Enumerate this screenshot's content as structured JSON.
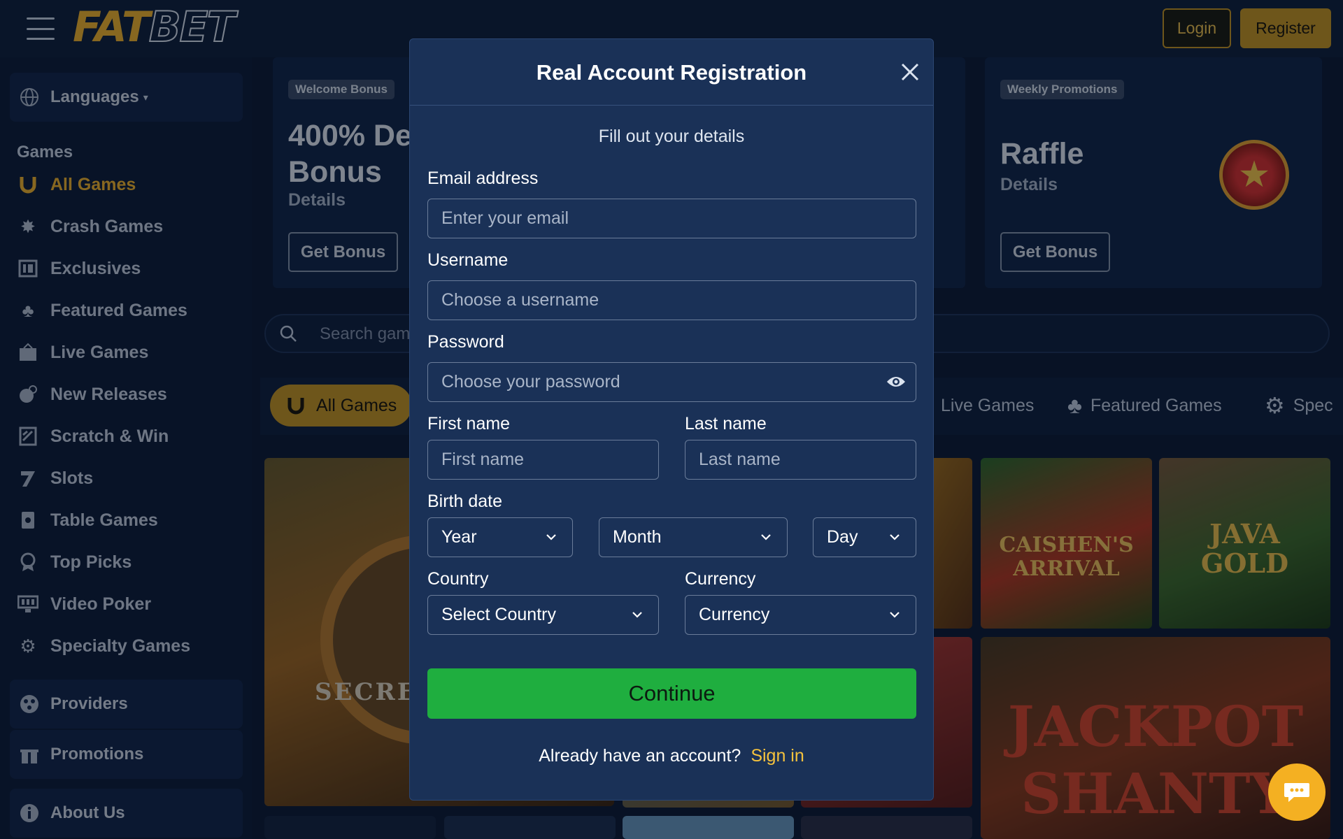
{
  "header": {
    "logo_fat": "FAT",
    "logo_bet": "BET",
    "login_label": "Login",
    "register_label": "Register"
  },
  "sidebar": {
    "languages_label": "Languages",
    "games_heading": "Games",
    "items": [
      {
        "label": "All Games",
        "icon": "horseshoe-icon",
        "active": true
      },
      {
        "label": "Crash Games",
        "icon": "crash-icon"
      },
      {
        "label": "Exclusives",
        "icon": "exclusive-icon"
      },
      {
        "label": "Featured Games",
        "icon": "clover-icon"
      },
      {
        "label": "Live Games",
        "icon": "live-icon"
      },
      {
        "label": "New Releases",
        "icon": "new-icon"
      },
      {
        "label": "Scratch & Win",
        "icon": "scratch-icon"
      },
      {
        "label": "Slots",
        "icon": "slot-icon"
      },
      {
        "label": "Table Games",
        "icon": "table-icon"
      },
      {
        "label": "Top Picks",
        "icon": "top-picks-icon"
      },
      {
        "label": "Video Poker",
        "icon": "video-poker-icon"
      },
      {
        "label": "Specialty Games",
        "icon": "gear-icon"
      }
    ],
    "providers_label": "Providers",
    "promotions_label": "Promotions",
    "about_label": "About Us"
  },
  "promos": {
    "welcome_tag": "Welcome Bonus",
    "welcome_title_line1": "400% De",
    "welcome_title_line2": "Bonus",
    "welcome_details": "Details",
    "welcome_button": "Get Bonus",
    "weekly_tag": "Weekly Promotions",
    "weekly_title": "Raffle",
    "weekly_details": "Details",
    "weekly_button": "Get Bonus"
  },
  "search": {
    "placeholder": "Search gam"
  },
  "categories": {
    "all_games": "All Games",
    "live_games": "Live Games",
    "featured_games": "Featured Games",
    "specialty": "Spec"
  },
  "tiles": {
    "secret": "SECRET",
    "caishens": "CAISHEN'S ARRIVAL",
    "java_gold": "JAVA GOLD",
    "jackpot": "JACKPOT SHANTY"
  },
  "modal": {
    "title": "Real Account Registration",
    "subtitle": "Fill out your details",
    "email_label": "Email address",
    "email_placeholder": "Enter your email",
    "username_label": "Username",
    "username_placeholder": "Choose a username",
    "password_label": "Password",
    "password_placeholder": "Choose your password",
    "first_name_label": "First name",
    "first_name_placeholder": "First name",
    "last_name_label": "Last name",
    "last_name_placeholder": "Last name",
    "birth_date_label": "Birth date",
    "year_value": "Year",
    "month_value": "Month",
    "day_value": "Day",
    "country_label": "Country",
    "country_value": "Select Country",
    "currency_label": "Currency",
    "currency_value": "Currency",
    "continue_label": "Continue",
    "already_text": "Already have an account?",
    "signin_label": "Sign in"
  },
  "colors": {
    "accent": "#f5b52b",
    "continue_green": "#1fae3f",
    "modal_bg": "#1a3157",
    "page_bg": "#0d1a33"
  }
}
